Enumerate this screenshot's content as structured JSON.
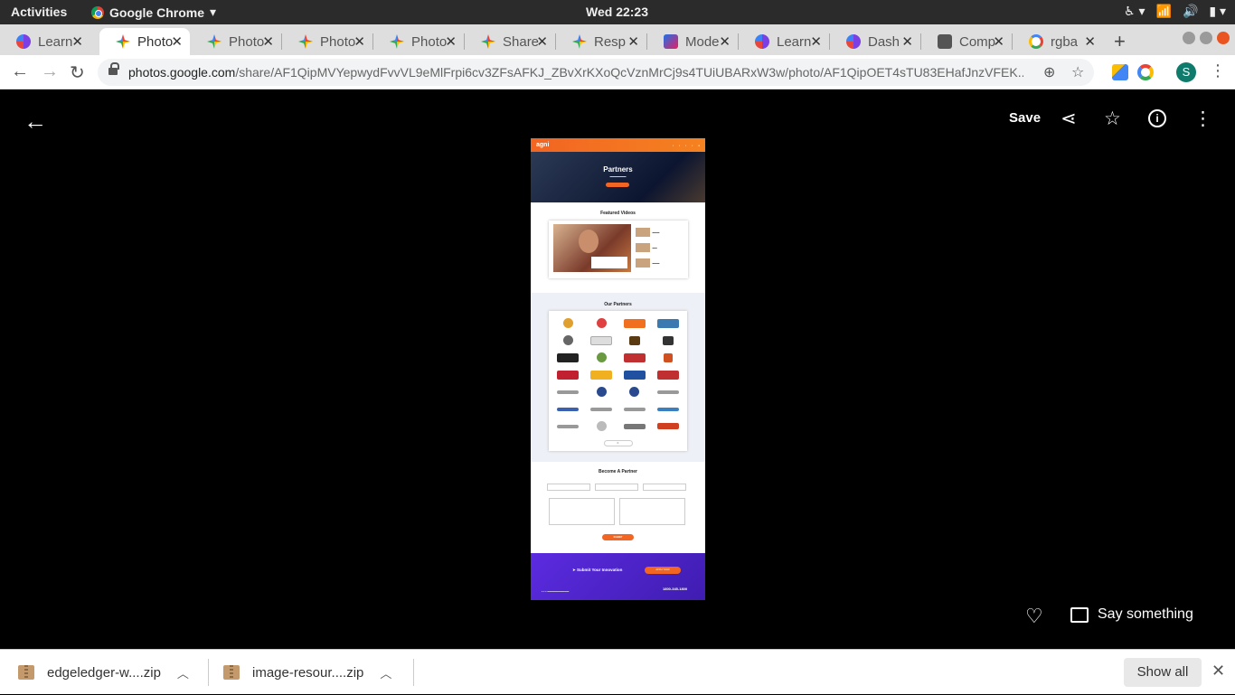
{
  "system": {
    "activities": "Activities",
    "app_name": "Google Chrome",
    "clock": "Wed 22:23"
  },
  "tabs": [
    {
      "label": "Learn",
      "icon": "learn-icon"
    },
    {
      "label": "Photo",
      "icon": "google-photos-icon",
      "active": true
    },
    {
      "label": "Photo",
      "icon": "google-photos-icon"
    },
    {
      "label": "Photo",
      "icon": "google-photos-icon"
    },
    {
      "label": "Photo",
      "icon": "google-photos-icon"
    },
    {
      "label": "Share",
      "icon": "google-photos-icon"
    },
    {
      "label": "Resp",
      "icon": "google-photos-icon"
    },
    {
      "label": "Mode",
      "icon": "model-icon"
    },
    {
      "label": "Learn",
      "icon": "learn-icon"
    },
    {
      "label": "Dash",
      "icon": "learn-icon"
    },
    {
      "label": "Comp",
      "icon": "comp-icon"
    },
    {
      "label": "rgba",
      "icon": "google-icon"
    }
  ],
  "toolbar": {
    "url_host": "photos.google.com",
    "url_path": "/share/AF1QipMVYepwydFvvVL9eMlFrpi6cv3ZFsAFKJ_ZBvXrKXoQcVznMrCj9s4TUiUBARxW3w/photo/AF1QipOET4sTU83EHafJnzVFEK...",
    "profile_initial": "S"
  },
  "viewer": {
    "save_label": "Save",
    "comment_label": "Say something"
  },
  "photo": {
    "brand": "agni",
    "hero_title": "Partners",
    "featured_title": "Featured Videos",
    "partners_title": "Our Partners",
    "become_title": "Become A Partner",
    "submit_label": "SUBMIT",
    "footer_cta": "Submit Your Innovation",
    "footer_apply": "APPLY NOW",
    "footer_phone": "1800-345-1800"
  },
  "downloads": [
    {
      "name": "edgeledger-w....zip"
    },
    {
      "name": "image-resour....zip"
    }
  ],
  "downloads_bar": {
    "show_all": "Show all"
  }
}
